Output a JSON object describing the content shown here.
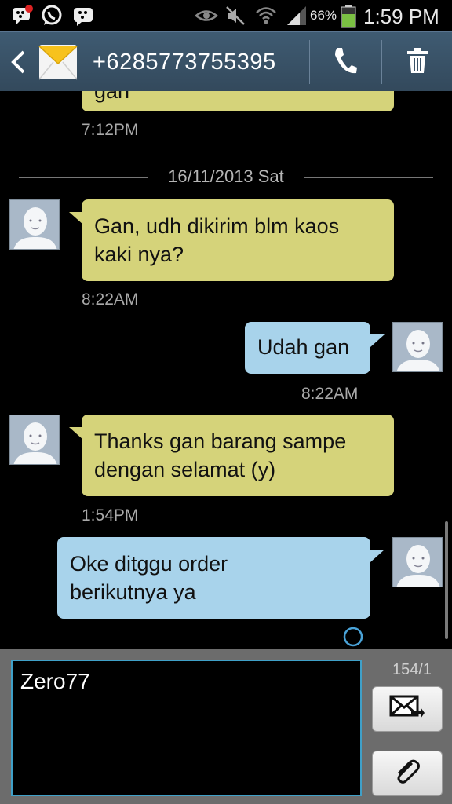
{
  "status_bar": {
    "battery_percent": "66%",
    "clock": "1:59 PM",
    "left_icons": [
      "bbm-notification-icon",
      "whatsapp-icon",
      "bbm-icon"
    ],
    "right_icons": [
      "eye-icon",
      "mute-icon",
      "wifi-icon",
      "signal-icon",
      "battery-icon"
    ]
  },
  "header": {
    "contact": "+6285773755395",
    "icons": [
      "back-icon",
      "envelope-icon",
      "phone-icon",
      "trash-icon"
    ]
  },
  "conversation": {
    "partial_text": "gan",
    "partial_time": "7:12PM",
    "date_separator": "16/11/2013 Sat",
    "messages": [
      {
        "direction": "in",
        "text_lines": [
          "Gan, udh dikirim blm kaos",
          "kaki nya?"
        ],
        "time": "8:22AM"
      },
      {
        "direction": "out",
        "text_lines": [
          "Udah gan"
        ],
        "time": "8:22AM"
      },
      {
        "direction": "in",
        "text_lines": [
          "Thanks gan barang sampe",
          "dengan selamat (y)"
        ],
        "time": "1:54PM"
      },
      {
        "direction": "out",
        "text_lines": [
          "Oke ditggu order",
          "berikutnya ya"
        ],
        "time": ""
      }
    ]
  },
  "composer": {
    "input_value": "Zero77",
    "counter": "154/1"
  },
  "colors": {
    "incoming_bubble": "#d5d37a",
    "outgoing_bubble": "#a8d3eb",
    "header_bg": "#3a5267",
    "input_border": "#3fa0c8"
  }
}
